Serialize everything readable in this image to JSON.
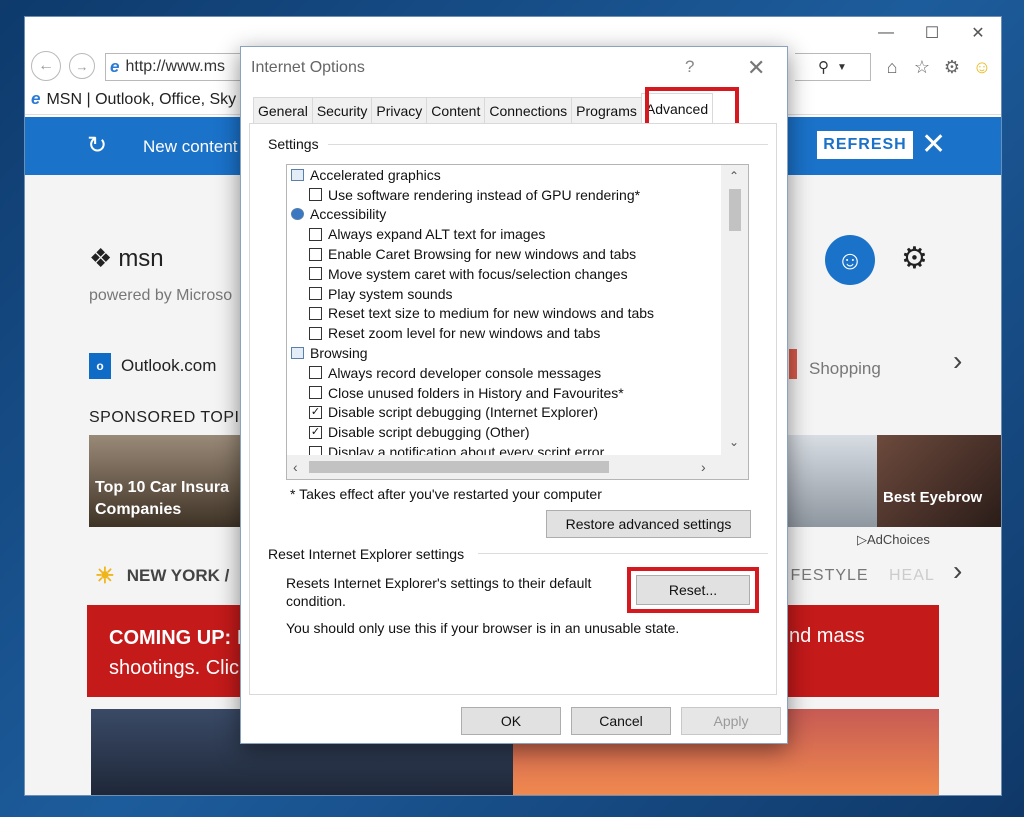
{
  "browser": {
    "address": "http://www.ms",
    "tab_title": "MSN | Outlook, Office, Sky",
    "icons": [
      "back-icon",
      "forward-icon",
      "ie-icon",
      "search-icon",
      "home-icon",
      "star-icon",
      "gear-icon",
      "smiley-icon"
    ]
  },
  "msn": {
    "banner_text": "New content",
    "refresh_label": "REFRESH",
    "logo_text": "msn",
    "logo_sub": "powered by Microso",
    "outlook_label": "Outlook.com",
    "outlook_icon_text": "o",
    "shopping_label": "Shopping",
    "sponsored_label": "SPONSORED TOPIC",
    "card1_text": "Top 10 Car Insura Companies",
    "card3_text": "Best Eyebrow",
    "adchoices": "AdChoices",
    "weather_label": "NEW YORK /",
    "lifestyle_label": "IFESTYLE",
    "heal_label": "HEAL",
    "coming_up_bold": "COMING UP:",
    "coming_up_rest": " F",
    "coming_up_line2": "shootings. Clic",
    "coming_up_right": "nd mass"
  },
  "dialog": {
    "title": "Internet Options",
    "help": "?",
    "tabs": [
      "General",
      "Security",
      "Privacy",
      "Content",
      "Connections",
      "Programs",
      "Advanced"
    ],
    "active_tab": "Advanced",
    "settings_label": "Settings",
    "settings_items": [
      {
        "type": "cat",
        "icon": "monitor",
        "label": "Accelerated graphics"
      },
      {
        "type": "opt",
        "checked": false,
        "label": "Use software rendering instead of GPU rendering*"
      },
      {
        "type": "cat",
        "icon": "round",
        "label": "Accessibility"
      },
      {
        "type": "opt",
        "checked": false,
        "label": "Always expand ALT text for images"
      },
      {
        "type": "opt",
        "checked": false,
        "label": "Enable Caret Browsing for new windows and tabs"
      },
      {
        "type": "opt",
        "checked": false,
        "label": "Move system caret with focus/selection changes"
      },
      {
        "type": "opt",
        "checked": false,
        "label": "Play system sounds"
      },
      {
        "type": "opt",
        "checked": false,
        "label": "Reset text size to medium for new windows and tabs"
      },
      {
        "type": "opt",
        "checked": false,
        "label": "Reset zoom level for new windows and tabs"
      },
      {
        "type": "cat",
        "icon": "monitor",
        "label": "Browsing"
      },
      {
        "type": "opt",
        "checked": false,
        "label": "Always record developer console messages"
      },
      {
        "type": "opt",
        "checked": false,
        "label": "Close unused folders in History and Favourites*"
      },
      {
        "type": "opt",
        "checked": true,
        "label": "Disable script debugging (Internet Explorer)"
      },
      {
        "type": "opt",
        "checked": true,
        "label": "Disable script debugging (Other)"
      },
      {
        "type": "opt",
        "checked": false,
        "label": "Display a notification about every script error"
      }
    ],
    "restart_note": "* Takes effect after you've restarted your computer",
    "restore_label": "Restore advanced settings",
    "reset_group_label": "Reset Internet Explorer settings",
    "reset_desc": "Resets Internet Explorer's settings to their default condition.",
    "reset_button": "Reset...",
    "reset_warning": "You should only use this if your browser is in an unusable state.",
    "ok": "OK",
    "cancel": "Cancel",
    "apply": "Apply",
    "highlight_color": "#d6181f"
  }
}
